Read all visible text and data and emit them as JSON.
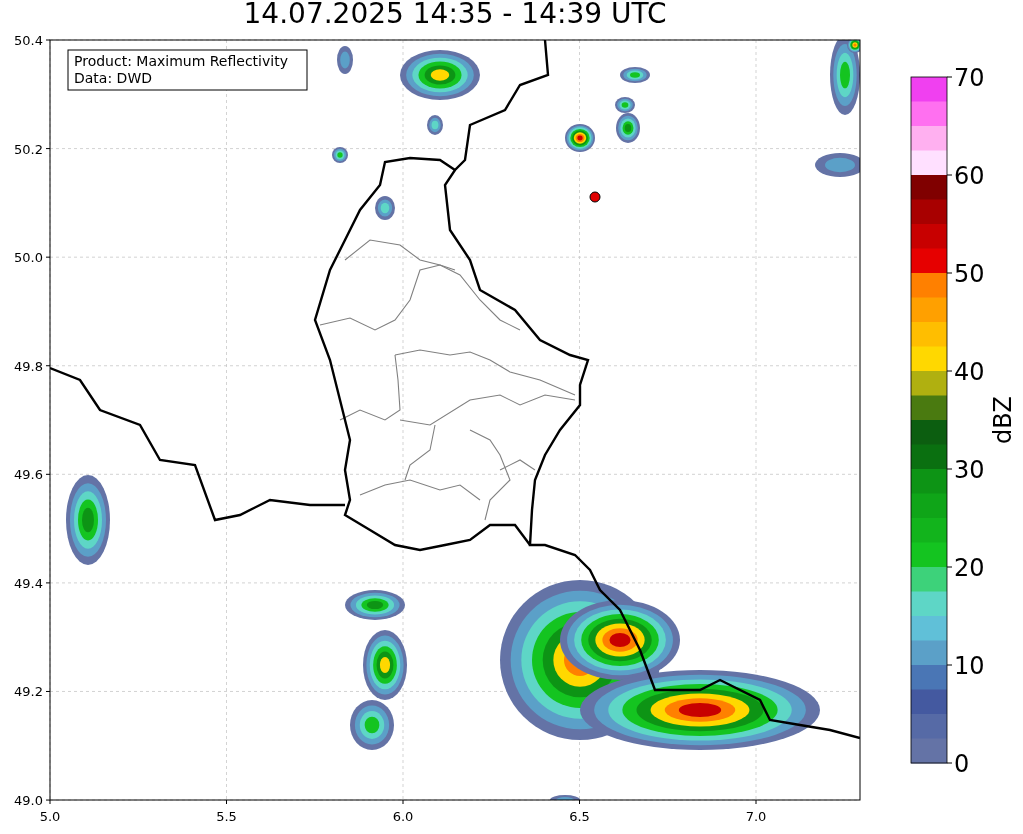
{
  "title": "14.07.2025 14:35 - 14:39 UTC",
  "info_box": {
    "lines": [
      "Product: Maximum Reflectivity",
      "Data: DWD"
    ]
  },
  "x_ticks": [
    "5.0",
    "5.5",
    "6.0",
    "6.5",
    "7.0"
  ],
  "y_ticks": [
    "50.4",
    "50.2",
    "50.0",
    "49.8",
    "49.6",
    "49.4",
    "49.2",
    "49.0"
  ],
  "colorbar": {
    "label": "dBZ",
    "ticks": [
      "70",
      "60",
      "50",
      "40",
      "30",
      "20",
      "10",
      "0"
    ],
    "bands": [
      {
        "color": "#f040f0"
      },
      {
        "color": "#ff70f0"
      },
      {
        "color": "#ffb0f0"
      },
      {
        "color": "#ffe0ff"
      },
      {
        "color": "#800000"
      },
      {
        "color": "#a80000"
      },
      {
        "color": "#c80000"
      },
      {
        "color": "#e60000"
      },
      {
        "color": "#ff8000"
      },
      {
        "color": "#ffa000"
      },
      {
        "color": "#ffbe00"
      },
      {
        "color": "#ffd800"
      },
      {
        "color": "#b0b010"
      },
      {
        "color": "#4a7a10"
      },
      {
        "color": "#0c5e10"
      },
      {
        "color": "#0a7010"
      },
      {
        "color": "#0d9415"
      },
      {
        "color": "#0fa518"
      },
      {
        "color": "#12b41c"
      },
      {
        "color": "#14c420"
      },
      {
        "color": "#3dd27a"
      },
      {
        "color": "#5ed6c6"
      },
      {
        "color": "#60c0d8"
      },
      {
        "color": "#5ba0c8"
      },
      {
        "color": "#4a76b5"
      },
      {
        "color": "#4459a0"
      },
      {
        "color": "#566aa6"
      },
      {
        "color": "#6473a6"
      }
    ]
  }
}
